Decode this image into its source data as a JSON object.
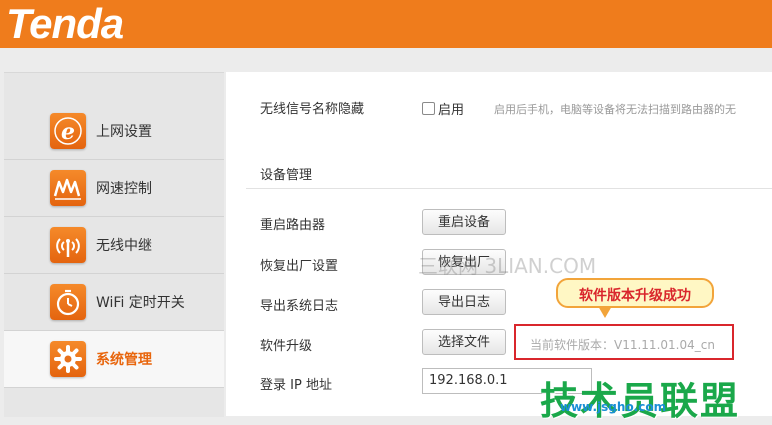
{
  "header": {
    "logo_text": "Tenda",
    "bar_color": "#ef7c1c"
  },
  "sidebar": {
    "items": [
      {
        "label": "上网设置",
        "icon": "internet-e-icon",
        "active": false
      },
      {
        "label": "网速控制",
        "icon": "speed-wave-icon",
        "active": false
      },
      {
        "label": "无线中继",
        "icon": "wireless-antenna-icon",
        "active": false
      },
      {
        "label": "WiFi 定时开关",
        "icon": "timer-clock-icon",
        "active": false
      },
      {
        "label": "系统管理",
        "icon": "gear-icon",
        "active": true
      }
    ]
  },
  "wifi_hide": {
    "label": "无线信号名称隐藏",
    "enable_label": "启用",
    "checked": false,
    "hint": "启用后手机，电脑等设备将无法扫描到路由器的无"
  },
  "device_mgmt": {
    "title": "设备管理",
    "reboot": {
      "label": "重启路由器",
      "button": "重启设备"
    },
    "reset": {
      "label": "恢复出厂设置",
      "button": "恢复出厂"
    },
    "export_log": {
      "label": "导出系统日志",
      "button": "导出日志"
    },
    "upgrade": {
      "label": "软件升级",
      "button": "选择文件",
      "version_text": "当前软件版本：V11.11.01.04_cn",
      "callout": "软件版本升级成功"
    },
    "login_ip": {
      "label": "登录 IP 地址",
      "value": "192.168.0.1"
    }
  },
  "watermarks": {
    "mid": "三联网 3LIAN.COM",
    "corner_cn": "技术员联盟",
    "corner_url": "www.jsgho.com"
  },
  "colors": {
    "accent": "#e8650c",
    "alert_red": "#d9262c",
    "callout_border": "#f2a43a"
  }
}
